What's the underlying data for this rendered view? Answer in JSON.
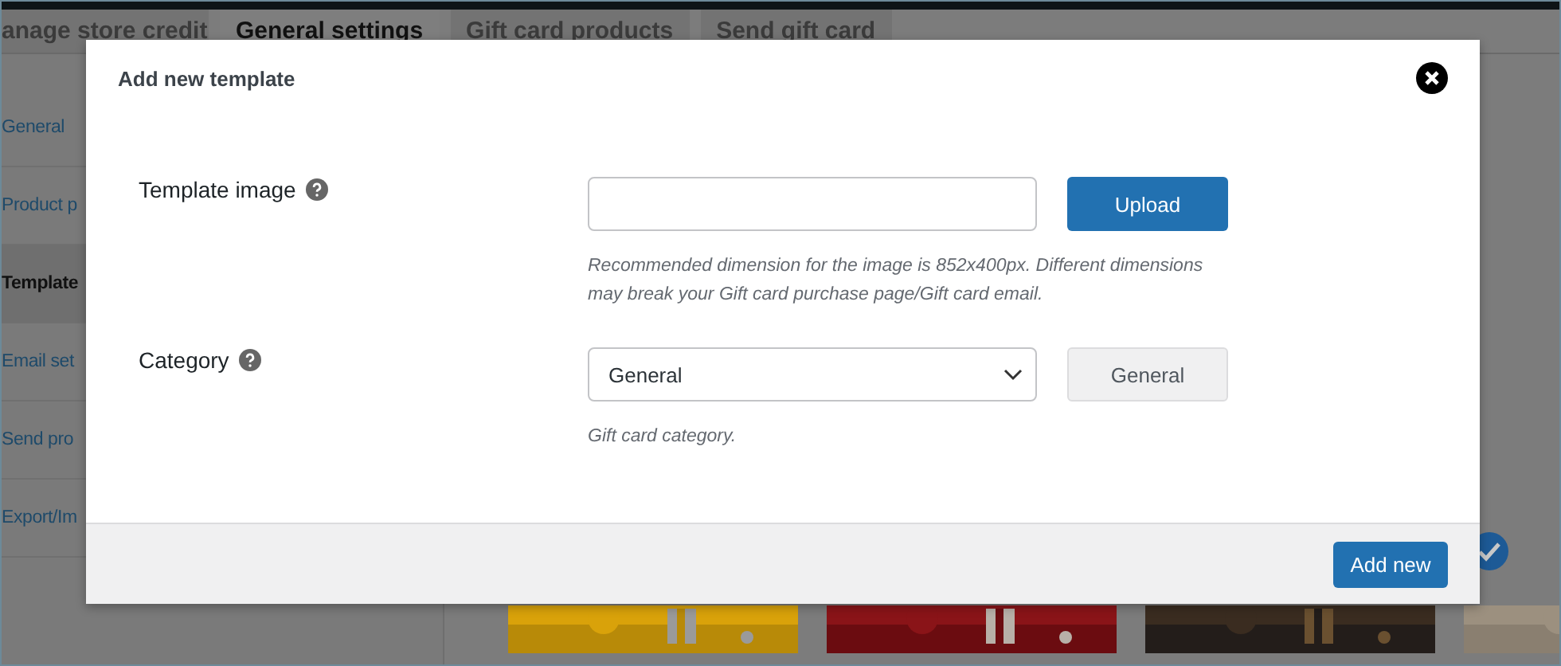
{
  "tabs": [
    {
      "label": "anage store credit",
      "selected": false
    },
    {
      "label": "General settings",
      "selected": true
    },
    {
      "label": "Gift card products",
      "selected": false
    },
    {
      "label": "Send gift card",
      "selected": false
    }
  ],
  "sidebar": {
    "items": [
      {
        "label": "General",
        "selected": false
      },
      {
        "label": "Product p",
        "selected": false
      },
      {
        "label": "Template",
        "selected": true
      },
      {
        "label": "Email set",
        "selected": false
      },
      {
        "label": "Send pro",
        "selected": false
      },
      {
        "label": "Export/Im",
        "selected": false
      }
    ]
  },
  "templates": [
    {
      "kind": "picture",
      "selected": false
    },
    {
      "kind": "picture",
      "selected": false
    },
    {
      "kind": "picture",
      "selected": false
    },
    {
      "kind": "picture",
      "selected": true
    }
  ],
  "modal": {
    "title": "Add new template",
    "fields": [
      {
        "kind": "upload",
        "label": "Template image",
        "button": "Upload",
        "description": "Recommended dimension for the image is 852x400px. Different dimensions may break your Gift card purchase page/Gift card email."
      },
      {
        "kind": "select",
        "label": "Category",
        "value": "General",
        "side_value": "General",
        "description": "Gift card category."
      }
    ],
    "footer_button": "Add new"
  }
}
